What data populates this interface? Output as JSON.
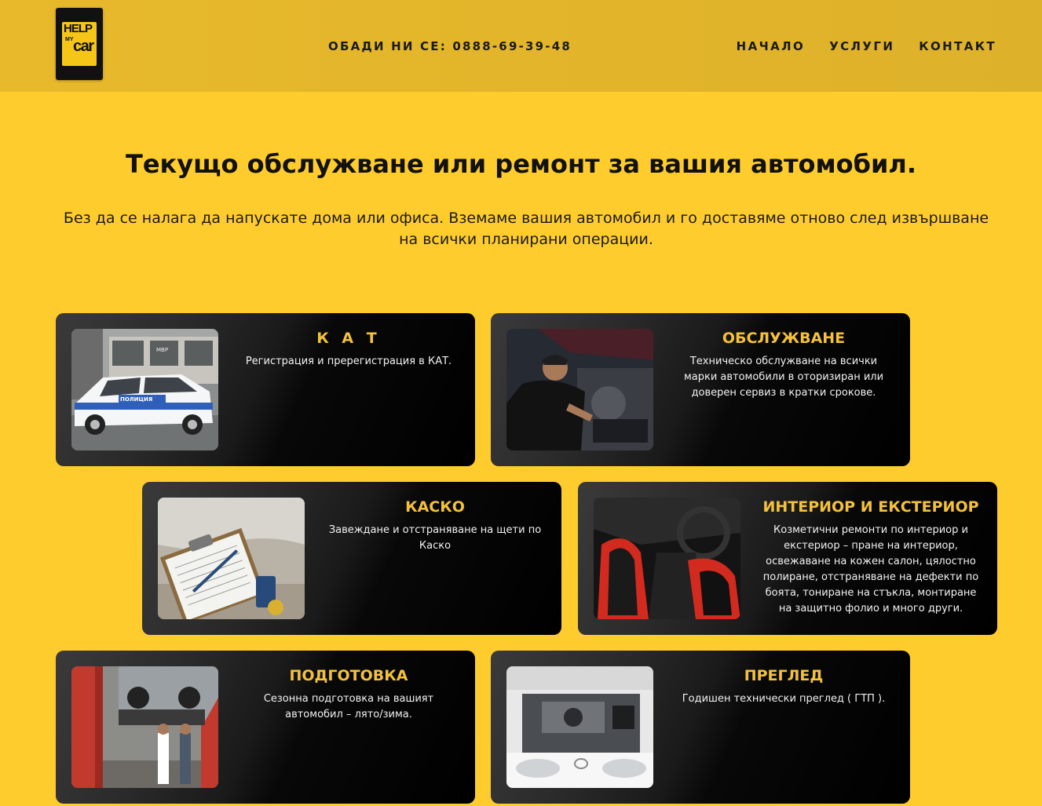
{
  "header": {
    "logo": {
      "line1": "HELP",
      "line2": "MY",
      "line3": "car"
    },
    "phone": "ОБАДИ НИ СЕ: 0888-69-39-48",
    "nav": [
      "НАЧАЛО",
      "УСЛУГИ",
      "КОНТАКТ"
    ]
  },
  "hero": {
    "title": "Текущо обслужване или ремонт за вашия автомобил.",
    "subtitle": "Без да се налага да напускате дома или офиса. Вземаме вашия автомобил и го доставяме отново след извършване на всички планирани операции."
  },
  "services": [
    {
      "title": "К А Т",
      "text": "Регистрация и пререгистрация в КАТ."
    },
    {
      "title": "ОБСЛУЖВАНЕ",
      "text": "Техническо обслужване на всички марки автомобили в оторизиран или доверен сервиз в кратки срокове."
    },
    {
      "title": "КАСКО",
      "text": "Завеждане и отстраняване на щети по Каско"
    },
    {
      "title": "ИНТЕРИОР И ЕКСТЕРИОР",
      "text": "Козметични ремонти по интериор и екстериор – пране на интериор, освежаване на кожен салон, цялостно полиране, отстраняване на дефекти по боята, тониране на стъкла, монтиране на защитно фолио и много други."
    },
    {
      "title": "ПОДГОТОВКА",
      "text": "Сезонна подготовка на вашият автомобил – лято/зима."
    },
    {
      "title": "ПРЕГЛЕД",
      "text": "Годишен технически преглед ( ГТП )."
    }
  ],
  "images": {
    "police_car_text": "ПОЛИЦИЯ",
    "building_sign": "МВР"
  },
  "colors": {
    "background": "#ffcc2e",
    "header": "#e0b42a",
    "card_title": "#f4c13b",
    "card_text": "#f2f2f2"
  }
}
